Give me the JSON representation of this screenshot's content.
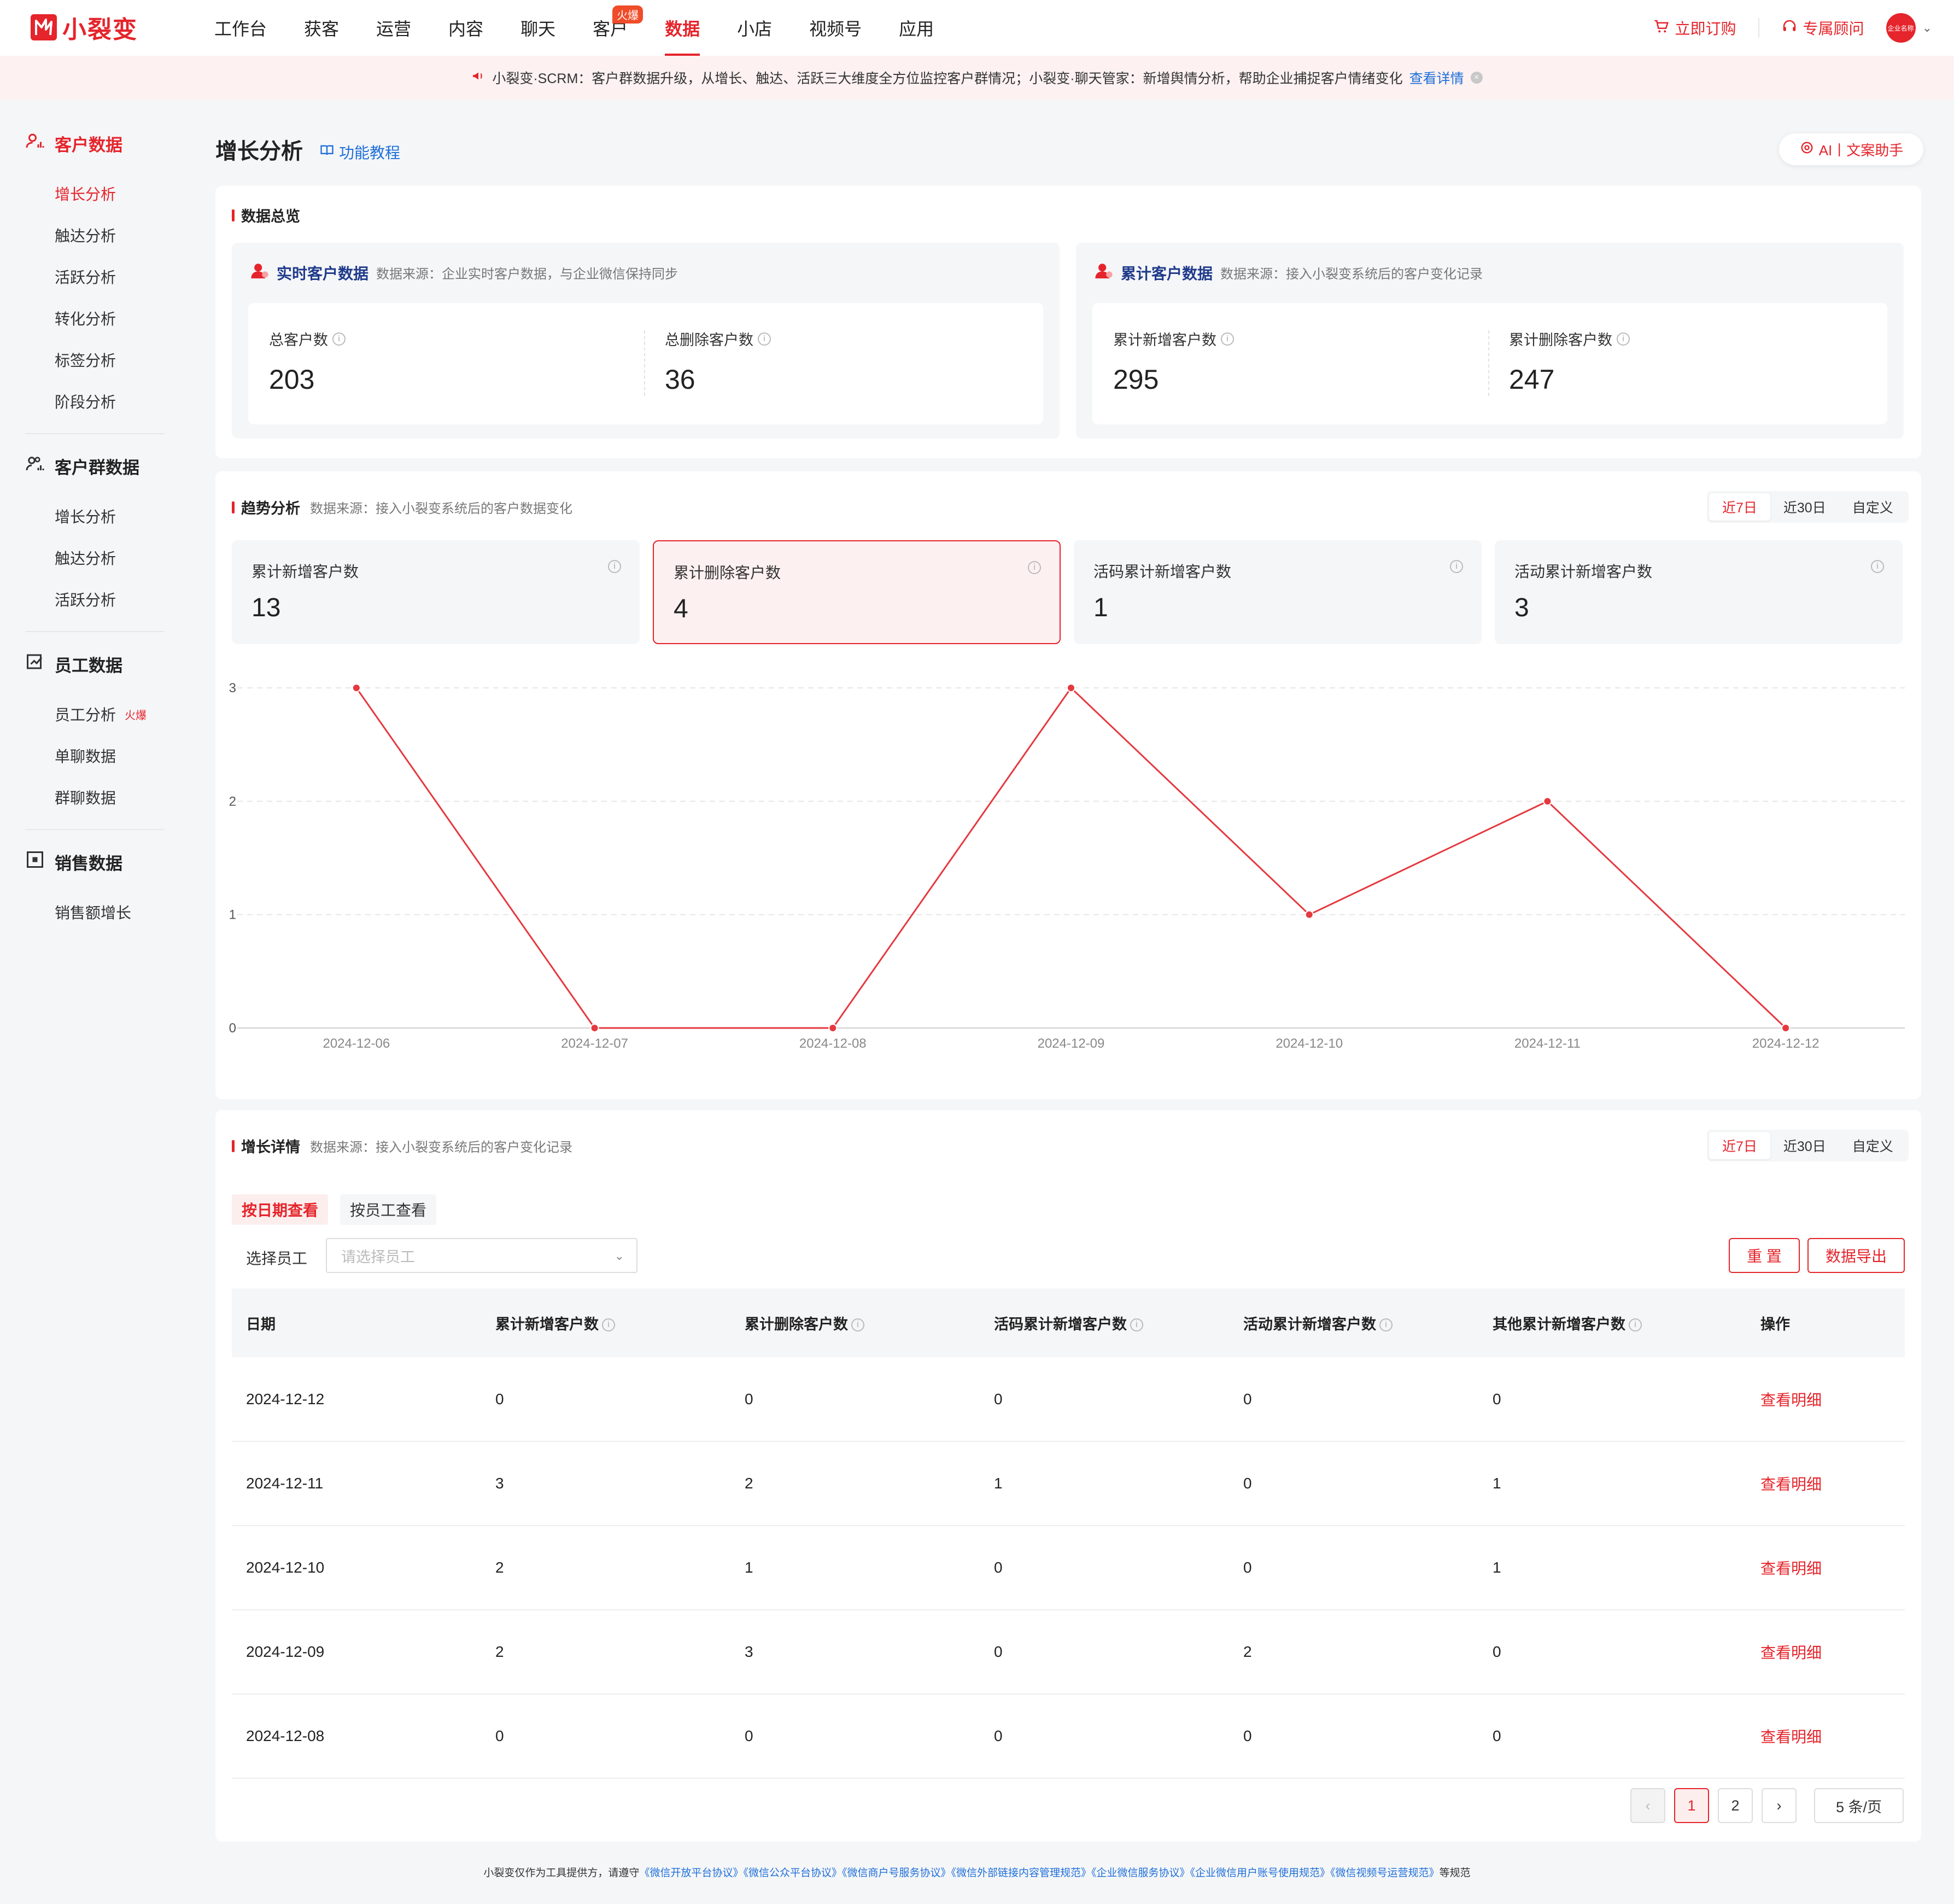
{
  "brand": {
    "name": "小裂变"
  },
  "nav": {
    "items": [
      "工作台",
      "获客",
      "运营",
      "内容",
      "聊天",
      "客户",
      "数据",
      "小店",
      "视频号",
      "应用"
    ],
    "active_index": 6,
    "hot_badge": "火爆",
    "order_label": "立即订购",
    "advisor_label": "专属顾问",
    "avatar_text": "企业名称"
  },
  "notice": {
    "text": "小裂变·SCRM：客户群数据升级，从增长、触达、活跃三大维度全方位监控客户群情况；小裂变·聊天管家：新增舆情分析，帮助企业捕捉客户情绪变化",
    "link": "查看详情"
  },
  "sidebar": {
    "groups": [
      {
        "title": "客户数据",
        "active": true,
        "items": [
          "增长分析",
          "触达分析",
          "活跃分析",
          "转化分析",
          "标签分析",
          "阶段分析"
        ]
      },
      {
        "title": "客户群数据",
        "active": false,
        "items": [
          "增长分析",
          "触达分析",
          "活跃分析"
        ]
      },
      {
        "title": "员工数据",
        "active": false,
        "items": [
          "员工分析",
          "单聊数据",
          "群聊数据"
        ],
        "hot_item": "火爆"
      },
      {
        "title": "销售数据",
        "active": false,
        "items": [
          "销售额增长"
        ]
      }
    ]
  },
  "header": {
    "title": "增长分析",
    "tutorial": "功能教程",
    "ai_label": "AI丨文案助手"
  },
  "overview": {
    "title": "数据总览",
    "realtime": {
      "title": "实时客户数据",
      "source": "数据来源：企业实时客户数据，与企业微信保持同步",
      "stats": [
        {
          "label": "总客户数",
          "value": "203"
        },
        {
          "label": "总删除客户数",
          "value": "36"
        }
      ]
    },
    "cumulative": {
      "title": "累计客户数据",
      "source": "数据来源：接入小裂变系统后的客户变化记录",
      "stats": [
        {
          "label": "累计新增客户数",
          "value": "295"
        },
        {
          "label": "累计删除客户数",
          "value": "247"
        }
      ]
    }
  },
  "trend": {
    "title": "趋势分析",
    "source": "数据来源：接入小裂变系统后的客户数据变化",
    "ranges": [
      "近7日",
      "近30日",
      "自定义"
    ],
    "metrics": [
      {
        "label": "累计新增客户数",
        "value": "13"
      },
      {
        "label": "累计删除客户数",
        "value": "4"
      },
      {
        "label": "活码累计新增客户数",
        "value": "1"
      },
      {
        "label": "活动累计新增客户数",
        "value": "3"
      }
    ],
    "selected_metric": 1
  },
  "chart_data": {
    "type": "line",
    "x": [
      "2024-12-06",
      "2024-12-07",
      "2024-12-08",
      "2024-12-09",
      "2024-12-10",
      "2024-12-11",
      "2024-12-12"
    ],
    "series": [
      {
        "values": [
          3,
          0,
          0,
          3,
          1,
          2,
          0
        ]
      }
    ],
    "ylim": [
      0,
      3
    ],
    "yticks": [
      0,
      1,
      2,
      3
    ],
    "grid": true,
    "color": "#e5393f"
  },
  "detail": {
    "title": "增长详情",
    "source": "数据来源：接入小裂变系统后的客户变化记录",
    "ranges": [
      "近7日",
      "近30日",
      "自定义"
    ],
    "tabs": [
      "按日期查看",
      "按员工查看"
    ],
    "filter_label": "选择员工",
    "filter_placeholder": "请选择员工",
    "reset_label": "重 置",
    "export_label": "数据导出",
    "columns": [
      "日期",
      "累计新增客户数",
      "累计删除客户数",
      "活码累计新增客户数",
      "活动累计新增客户数",
      "其他累计新增客户数",
      "操作"
    ],
    "rows": [
      [
        "2024-12-12",
        "0",
        "0",
        "0",
        "0",
        "0",
        "查看明细"
      ],
      [
        "2024-12-11",
        "3",
        "2",
        "1",
        "0",
        "1",
        "查看明细"
      ],
      [
        "2024-12-10",
        "2",
        "1",
        "0",
        "0",
        "1",
        "查看明细"
      ],
      [
        "2024-12-09",
        "2",
        "3",
        "0",
        "2",
        "0",
        "查看明细"
      ],
      [
        "2024-12-08",
        "0",
        "0",
        "0",
        "0",
        "0",
        "查看明细"
      ]
    ],
    "pager": {
      "pages": [
        "1",
        "2"
      ],
      "current": "1",
      "size": "5 条/页"
    }
  },
  "footer": {
    "prefix": "小裂变仅作为工具提供方，请遵守",
    "links": [
      "《微信开放平台协议》",
      "《微信公众平台协议》",
      "《微信商户号服务协议》",
      "《微信外部链接内容管理规范》",
      "《企业微信服务协议》",
      "《企业微信用户账号使用规范》",
      "《微信视频号运营规范》"
    ],
    "suffix": "等规范"
  },
  "colors": {
    "accent": "#e5242b",
    "link": "#1e6fd9",
    "title_blue": "#1f3a8a"
  }
}
